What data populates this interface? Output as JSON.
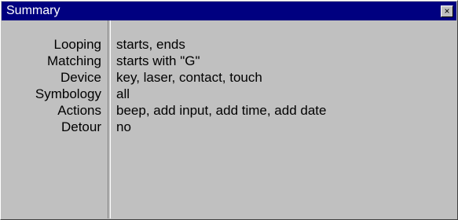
{
  "window": {
    "title": "Summary",
    "close_label": "×"
  },
  "summary": {
    "items": [
      {
        "label": "Looping",
        "value": "starts, ends"
      },
      {
        "label": "Matching",
        "value": "starts with \"G\""
      },
      {
        "label": "Device",
        "value": "key, laser, contact, touch"
      },
      {
        "label": "Symbology",
        "value": "all"
      },
      {
        "label": "Actions",
        "value": "beep, add input, add time, add date"
      },
      {
        "label": "Detour",
        "value": "no"
      }
    ]
  },
  "colors": {
    "titlebar": "#000080",
    "window_bg": "#c0c0c0",
    "text": "#000000"
  }
}
